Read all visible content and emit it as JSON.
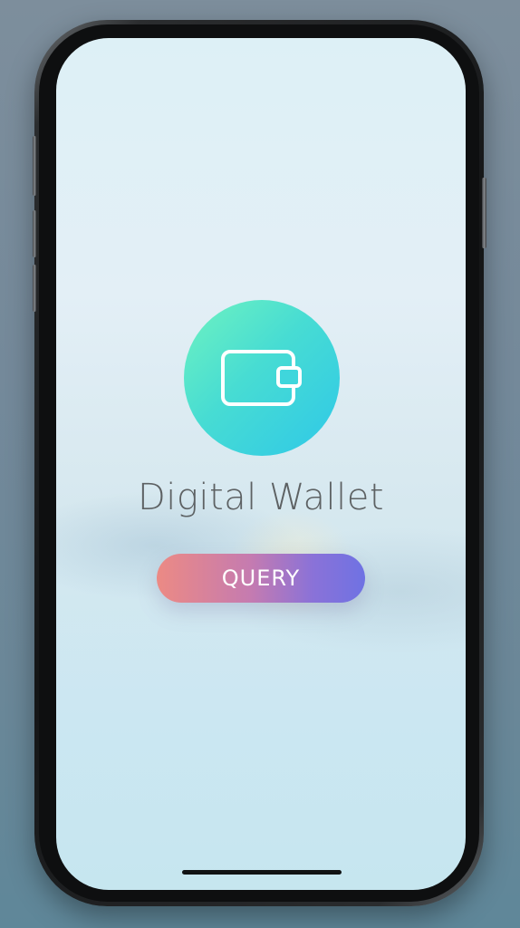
{
  "app": {
    "title": "Digital Wallet",
    "logo_icon": "wallet-icon",
    "logo_gradient": [
      "#6ff3c0",
      "#2fc8e8"
    ]
  },
  "actions": {
    "query_label": "QUERY",
    "query_gradient": [
      "#ec8a84",
      "#6f72e3"
    ]
  }
}
